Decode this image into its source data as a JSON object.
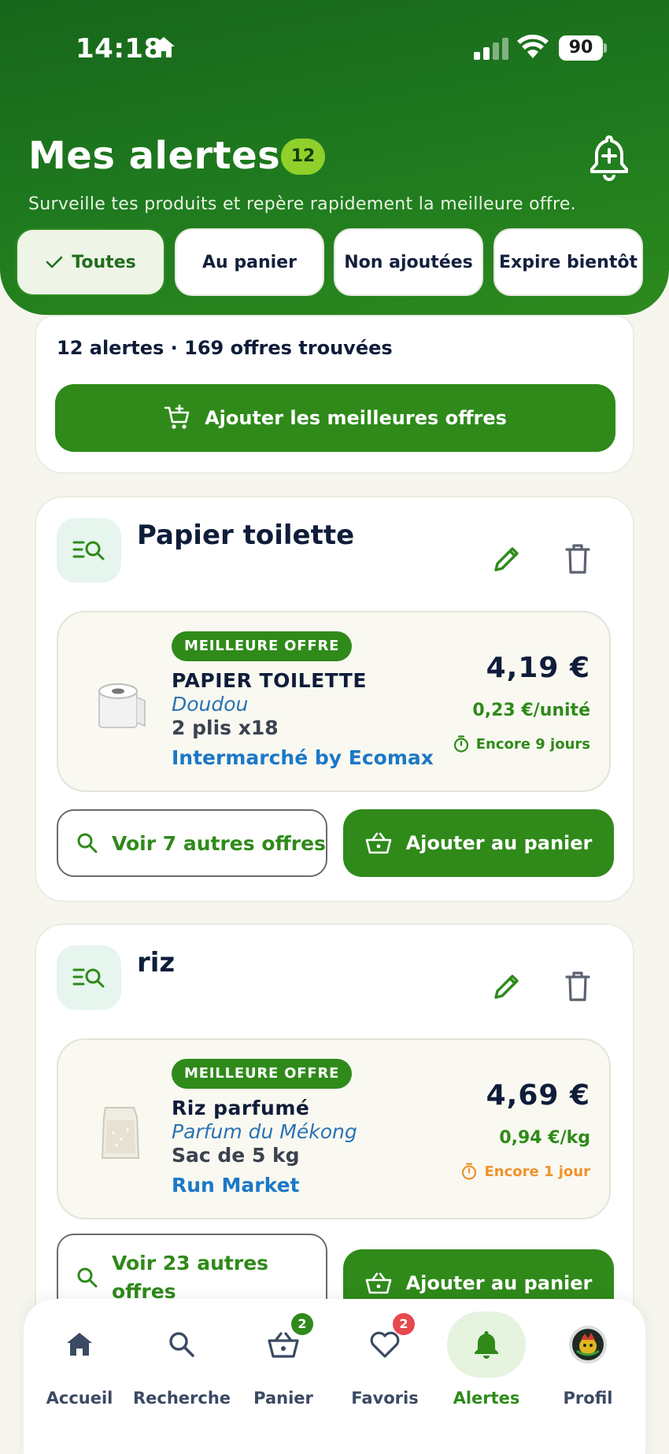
{
  "status_bar": {
    "time": "14:18",
    "battery": "90"
  },
  "header": {
    "title": "Mes alertes",
    "badge_count": "12",
    "subtitle": "Surveille tes produits et repère rapidement la meilleure offre."
  },
  "filters": [
    {
      "label": "Toutes",
      "active": true
    },
    {
      "label": "Au panier",
      "active": false
    },
    {
      "label": "Non ajoutées",
      "active": false
    },
    {
      "label": "Expire bientôt",
      "active": false
    }
  ],
  "summary": {
    "text": "12 alertes · 169 offres trouvées",
    "add_best_label": "Ajouter les meilleures offres"
  },
  "alerts": [
    {
      "title": "Papier toilette",
      "offer": {
        "badge": "MEILLEURE OFFRE",
        "name": "PAPIER TOILETTE",
        "brand": "Doudou",
        "size": "2 plis x18",
        "store": "Intermarché by Ecomax",
        "price": "4,19 €",
        "unit_price": "0,23 €/unité",
        "expiry": "Encore 9 jours"
      },
      "more_offers_label": "Voir 7 autres offres",
      "add_to_cart_label": "Ajouter au panier"
    },
    {
      "title": "riz",
      "offer": {
        "badge": "MEILLEURE OFFRE",
        "name": "Riz parfumé",
        "brand": "Parfum du Mékong",
        "size": "Sac de 5 kg",
        "store": "Run Market",
        "price": "4,69 €",
        "unit_price": "0,94 €/kg",
        "expiry": "Encore 1 jour"
      },
      "more_offers_label": "Voir 23 autres offres",
      "add_to_cart_label": "Ajouter au panier"
    }
  ],
  "tabbar": {
    "items": [
      {
        "label": "Accueil",
        "icon": "home-icon"
      },
      {
        "label": "Recherche",
        "icon": "search-icon"
      },
      {
        "label": "Panier",
        "icon": "basket-icon",
        "badge": "2"
      },
      {
        "label": "Favoris",
        "icon": "heart-icon",
        "badge": "2"
      },
      {
        "label": "Alertes",
        "icon": "bell-icon",
        "active": true
      },
      {
        "label": "Profil",
        "icon": "avatar"
      }
    ]
  },
  "colors": {
    "brand_green": "#2f8a1a",
    "header_green": "#17661b",
    "badge_red": "#e5484d",
    "warning_orange": "#f0922c",
    "link_blue": "#1c78c8"
  }
}
